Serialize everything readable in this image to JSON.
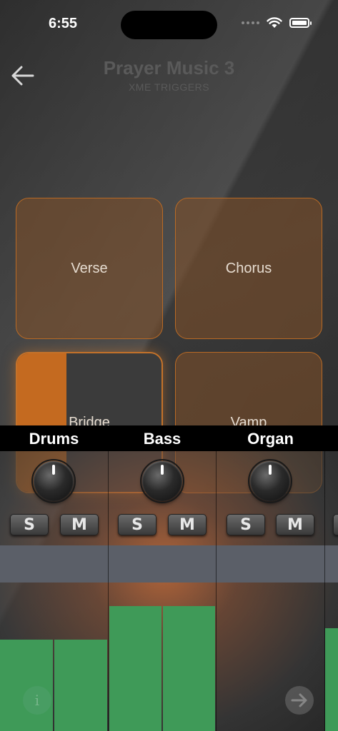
{
  "status": {
    "time": "6:55"
  },
  "header": {
    "title": "Prayer Music 3",
    "subtitle": "XME TRIGGERS"
  },
  "pads": [
    {
      "label": "Verse",
      "active": false
    },
    {
      "label": "Chorus",
      "active": false
    },
    {
      "label": "Bridge",
      "active": true,
      "progress": 0.34
    },
    {
      "label": "Vamp",
      "active": false
    }
  ],
  "mixer": {
    "strips": [
      {
        "name": "Drums",
        "solo": "S",
        "mute": "M",
        "meter_left": 0.3,
        "meter_right": 0.3
      },
      {
        "name": "Bass",
        "solo": "S",
        "mute": "M",
        "meter_left": 0.41,
        "meter_right": 0.41
      },
      {
        "name": "Organ",
        "solo": "S",
        "mute": "M",
        "meter_left": 0,
        "meter_right": 0
      }
    ],
    "colors": {
      "meter": "#3f9a58",
      "band": "#5b5f68",
      "accent": "#c46a20"
    }
  },
  "buttons": {
    "info": "i",
    "info_icon": "info-icon",
    "next_icon": "arrow-right-icon",
    "back_icon": "arrow-left-icon"
  }
}
